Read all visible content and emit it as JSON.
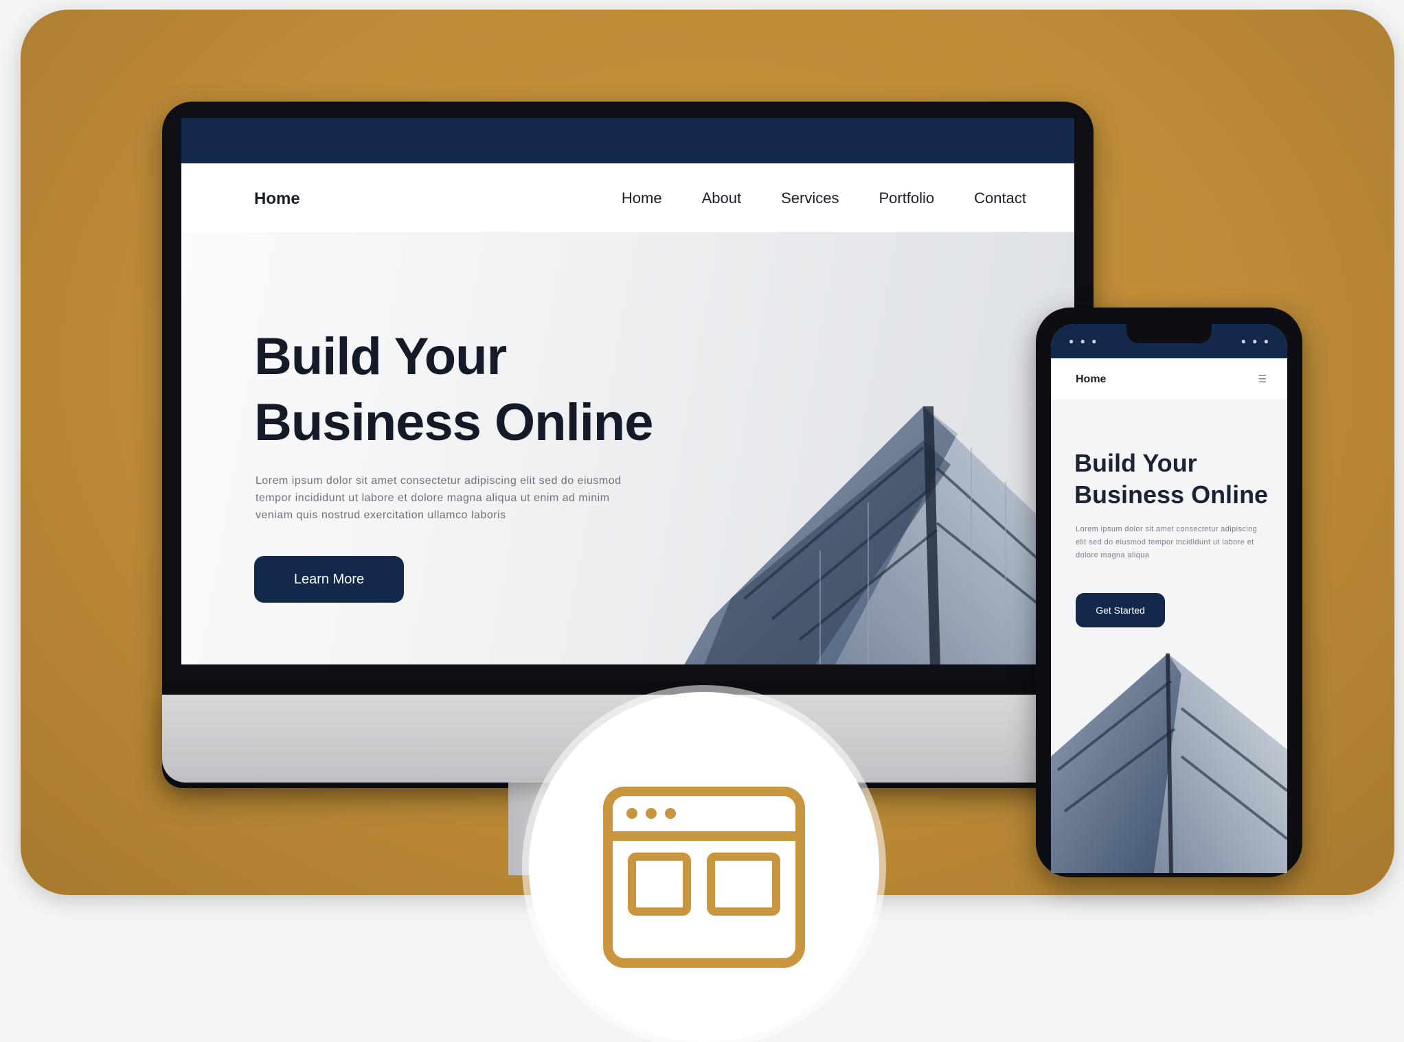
{
  "colors": {
    "background_panel": "#bd8c38",
    "brand_navy": "#13294b",
    "badge_icon": "#c9963f"
  },
  "desktop": {
    "logo": "Home",
    "nav": [
      "Home",
      "About",
      "Services",
      "Portfolio",
      "Contact"
    ],
    "hero": {
      "title_line1": "Build Your",
      "title_line2": "Business Online",
      "description": "Lorem ipsum dolor sit amet consectetur adipiscing elit sed do eiusmod tempor incididunt ut labore et dolore magna aliqua ut enim ad minim veniam quis nostrud exercitation ullamco laboris",
      "button": "Learn More"
    }
  },
  "phone": {
    "logo": "Home",
    "menu_icon": "menu-icon",
    "hero": {
      "title_line1": "Build Your",
      "title_line2": "Business Online",
      "description": "Lorem ipsum dolor sit amet consectetur adipiscing elit sed do eiusmod tempor incididunt ut labore et dolore magna aliqua",
      "button": "Get Started"
    }
  },
  "badge": {
    "icon": "browser-window-icon"
  }
}
